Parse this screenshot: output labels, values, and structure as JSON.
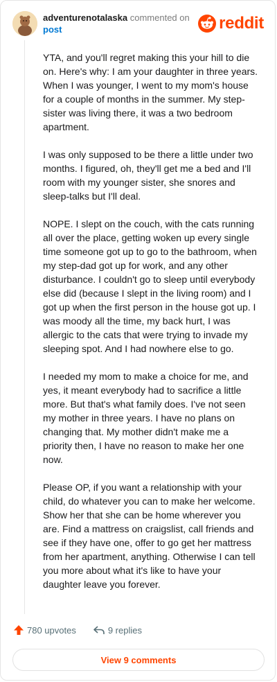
{
  "header": {
    "username": "adventurenotalaska",
    "action_text": "commented on",
    "post_link": "post",
    "brand": "reddit",
    "brand_color": "#ff4500"
  },
  "comment": {
    "paragraphs": [
      "YTA, and you'll regret making this your hill to die on. Here's why: I am your daughter in three years. When I was younger, I went to my mom's house for a couple of months in the summer. My step-sister was living there, it was a two bedroom apartment.",
      "I was only supposed to be there a little under two months. I figured, oh, they'll get me a bed and I'll room with my younger sister, she snores and sleep-talks but I'll deal.",
      "NOPE. I slept on the couch, with the cats running all over the place, getting woken up every single time someone got up to go to the bathroom, when my step-dad got up for work, and any other disturbance. I couldn't go to sleep until everybody else did (because I slept in the living room) and I got up when the first person in the house got up. I was moody all the time, my back hurt, I was allergic to the cats that were trying to invade my sleeping spot. And I had nowhere else to go.",
      "I needed my mom to make a choice for me, and yes, it meant everybody had to sacrifice a little more. But that's what family does. I've not seen my mother in three years. I have no plans on changing that. My mother didn't make me a priority then, I have no reason to make her one now.",
      "Please OP, if you want a relationship with your child, do whatever you can to make her welcome. Show her that she can be home wherever you are. Find a mattress on craigslist, call friends and see if they have one, offer to go get her mattress from her apartment, anything. Otherwise I can tell you more about what it's like to have your daughter leave you forever."
    ]
  },
  "footer": {
    "upvotes": "780 upvotes",
    "replies": "9 replies",
    "upvote_icon": "upvote-arrow-icon",
    "reply_icon": "reply-arrow-icon"
  },
  "view_comments_label": "View 9 comments"
}
